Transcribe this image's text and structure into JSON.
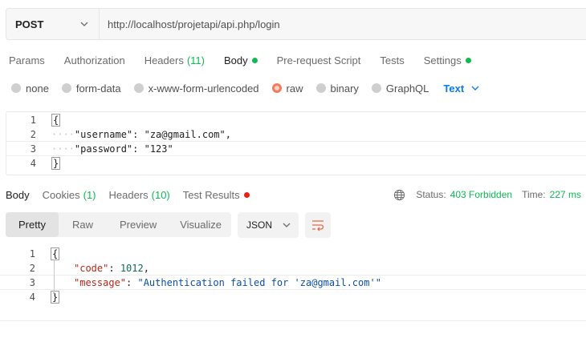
{
  "request": {
    "method": "POST",
    "url": "http://localhost/projetapi/api.php/login"
  },
  "request_tabs": [
    {
      "label": "Params"
    },
    {
      "label": "Authorization"
    },
    {
      "label": "Headers",
      "count": "(11)"
    },
    {
      "label": "Body",
      "active": true,
      "dot": "green"
    },
    {
      "label": "Pre-request Script"
    },
    {
      "label": "Tests"
    },
    {
      "label": "Settings",
      "dot": "green"
    }
  ],
  "body_types": {
    "options": [
      "none",
      "form-data",
      "x-www-form-urlencoded",
      "raw",
      "binary",
      "GraphQL"
    ],
    "selected": "raw",
    "format": "Text"
  },
  "request_body": {
    "line_numbers": [
      "1",
      "2",
      "3",
      "4"
    ],
    "open": "{",
    "key1": "\"username\"",
    "sep1": ": ",
    "val1": "\"za@gmail.com\",",
    "key2": "\"password\"",
    "sep2": ": ",
    "val2": "\"123\"",
    "close": "}",
    "indent": "····"
  },
  "response_tabs": [
    {
      "label": "Body",
      "active": true
    },
    {
      "label": "Cookies",
      "count": "(1)"
    },
    {
      "label": "Headers",
      "count": "(10)"
    },
    {
      "label": "Test Results",
      "dot": "red"
    }
  ],
  "response_status": {
    "status_label": "Status:",
    "status_value": "403 Forbidden",
    "time_label": "Time:",
    "time_value": "227 ms"
  },
  "view_modes": [
    "Pretty",
    "Raw",
    "Preview",
    "Visualize"
  ],
  "response_format": "JSON",
  "response_body": {
    "line_numbers": [
      "1",
      "2",
      "3",
      "4"
    ],
    "open": "{",
    "key1": "\"code\"",
    "sep1": ": ",
    "val1": "1012",
    "comma1": ",",
    "key2": "\"message\"",
    "sep2": ": ",
    "val2": "\"Authentication failed for 'za@gmail.com'\"",
    "close": "}"
  },
  "colors": {
    "accent_green": "#0cbb52",
    "accent_red": "#eb2013",
    "accent_blue": "#097bed",
    "radio_selected": "#f27c5d"
  }
}
